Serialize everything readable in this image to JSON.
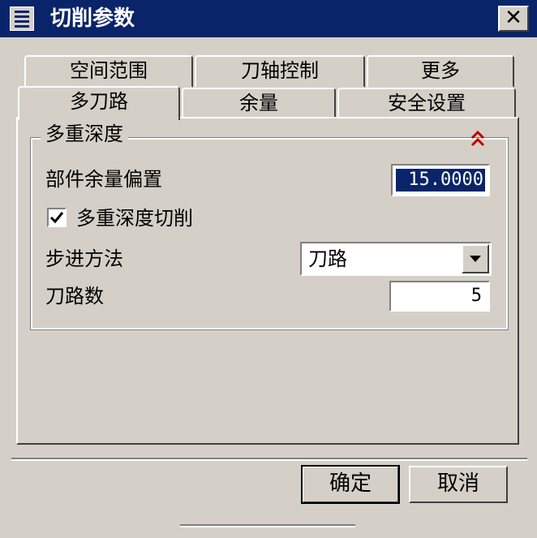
{
  "window": {
    "title": "切削参数",
    "close_glyph": "✕"
  },
  "tabs": {
    "row1": [
      {
        "label": "空间范围"
      },
      {
        "label": "刀轴控制"
      },
      {
        "label": "更多"
      }
    ],
    "row2": [
      {
        "label": "多刀路",
        "selected": true
      },
      {
        "label": "余量"
      },
      {
        "label": "安全设置"
      }
    ]
  },
  "group": {
    "title": "多重深度",
    "collapse_icon": "double-chevron-up-icon",
    "collapse_color": "#c00000"
  },
  "fields": {
    "part_stock_offset": {
      "label": "部件余量偏置",
      "value": "15.0000"
    },
    "multi_depth_cut": {
      "label": "多重深度切削",
      "checked": true
    },
    "step_method": {
      "label": "步进方法",
      "value": "刀路"
    },
    "pass_count": {
      "label": "刀路数",
      "value": "5"
    }
  },
  "buttons": {
    "ok": "确定",
    "cancel": "取消"
  },
  "colors": {
    "titlebar": "#0a246a",
    "face": "#d4d0c8"
  }
}
